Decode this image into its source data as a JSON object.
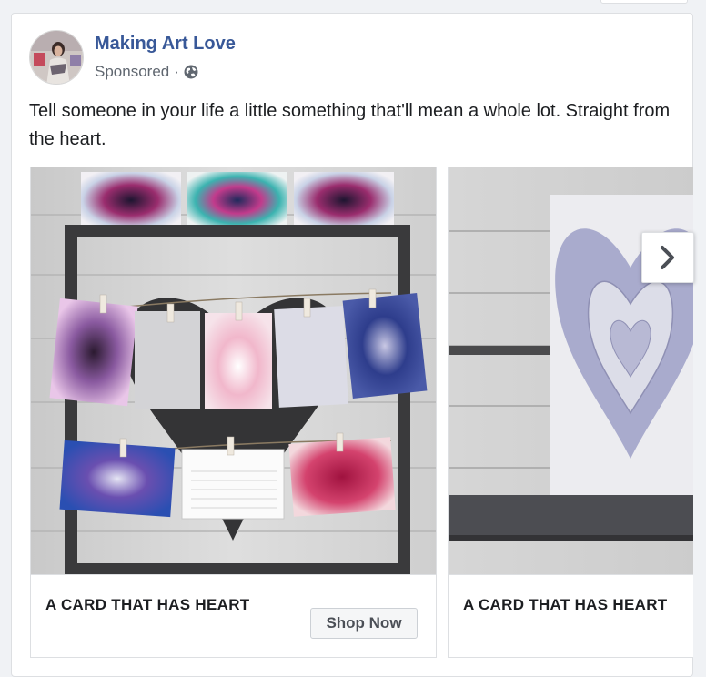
{
  "post": {
    "page_name": "Making Art Love",
    "sponsored_label": "Sponsored",
    "separator": "·",
    "audience_icon": "globe-icon",
    "text": "Tell someone in your life a little something that'll mean a whole lot. Straight from the heart."
  },
  "carousel": {
    "cards": [
      {
        "headline": "A CARD THAT HAS HEART",
        "cta_label": "Shop Now",
        "image": "heart-cards-frame-photo"
      },
      {
        "headline": "A CARD THAT HAS HEART",
        "image": "textured-heart-card-photo"
      }
    ],
    "next_icon": "chevron-right-icon"
  },
  "colors": {
    "page_name": "#385898",
    "meta_text": "#606770",
    "body_text": "#1c1e21",
    "border": "#dddfe2",
    "button_bg": "#f5f6f7"
  }
}
